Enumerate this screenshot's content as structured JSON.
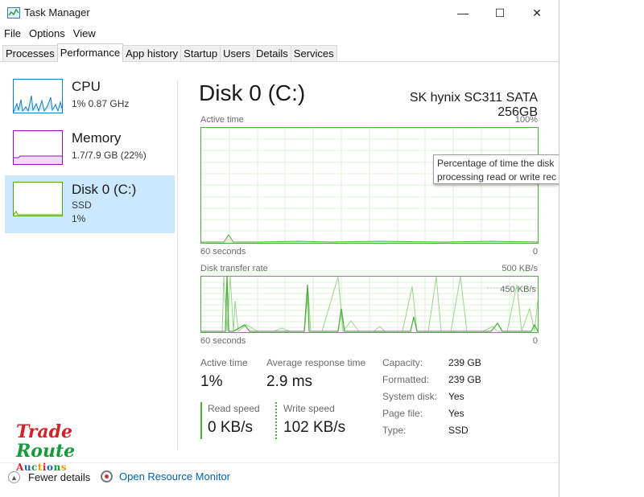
{
  "window": {
    "title": "Task Manager",
    "minimize": "—",
    "maximize": "☐",
    "close": "✕"
  },
  "menu": [
    "File",
    "Options",
    "View"
  ],
  "tabs": [
    "Processes",
    "Performance",
    "App history",
    "Startup",
    "Users",
    "Details",
    "Services"
  ],
  "active_tab": "Performance",
  "sidebar": {
    "items": [
      {
        "title": "CPU",
        "lines": [
          "1%  0.87 GHz"
        ],
        "color": "#117dbb"
      },
      {
        "title": "Memory",
        "lines": [
          "1.7/7.9 GB (22%)"
        ],
        "color": "#8b12ae"
      },
      {
        "title": "Disk 0 (C:)",
        "lines": [
          "SSD",
          "1%"
        ],
        "color": "#4da60c",
        "selected": true
      }
    ]
  },
  "main": {
    "title": "Disk 0 (C:)",
    "device": "SK hynix SC311 SATA 256GB",
    "active_graph": {
      "label": "Active time",
      "max": "100%",
      "time": "60 seconds",
      "min": "0"
    },
    "transfer_graph": {
      "label": "Disk transfer rate",
      "max": "500 KB/s",
      "mark": "450 KB/s",
      "time": "60 seconds",
      "min": "0"
    },
    "tooltip": [
      "Percentage of time the disk",
      "processing read or write rec"
    ],
    "stats": {
      "active_time_label": "Active time",
      "active_time": "1%",
      "avg_response_label": "Average response time",
      "avg_response": "2.9 ms",
      "read_label": "Read speed",
      "read": "0 KB/s",
      "write_label": "Write speed",
      "write": "102 KB/s"
    },
    "info": [
      {
        "label": "Capacity:",
        "value": "239 GB"
      },
      {
        "label": "Formatted:",
        "value": "239 GB"
      },
      {
        "label": "System disk:",
        "value": "Yes"
      },
      {
        "label": "Page file:",
        "value": "Yes"
      },
      {
        "label": "Type:",
        "value": "SSD"
      }
    ]
  },
  "footer": {
    "fewer_details": "Fewer details",
    "resource_monitor": "Open Resource Monitor"
  },
  "watermark": [
    "Trade",
    "Route",
    "Auctions"
  ],
  "colors": {
    "disk_green": "#4cae3c",
    "selected_bg": "#cce8ff",
    "link": "#0063b1"
  }
}
